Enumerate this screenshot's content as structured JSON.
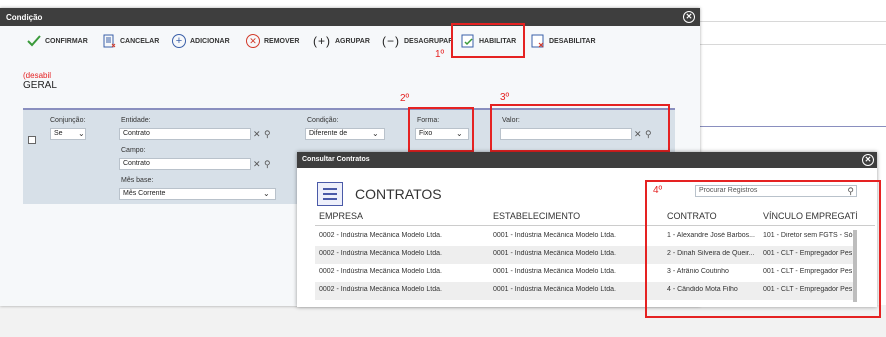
{
  "dialog": {
    "title": "Condição",
    "toolbar": {
      "confirmar": "CONFIRMAR",
      "cancelar": "CANCELAR",
      "adicionar": "ADICIONAR",
      "remover": "REMOVER",
      "agrupar": "AGRUPAR",
      "agrupar_sym": "(+)",
      "desagrupar": "DESAGRUPAR",
      "desagrupar_sym": "(−)",
      "habilitar": "HABILITAR",
      "desabilitar": "DESABILITAR"
    },
    "warning": "(desabil",
    "section": "GERAL",
    "form": {
      "conjuncao_label": "Conjunção:",
      "conjuncao_value": "Se",
      "entidade_label": "Entidade:",
      "entidade_value": "Contrato",
      "campo_label": "Campo:",
      "campo_value": "Contrato",
      "mes_base_label": "Mês base:",
      "mes_base_value": "Mês Corrente",
      "condicao_label": "Condição:",
      "condicao_value": "Diferente de",
      "forma_label": "Forma:",
      "forma_value": "Fixo",
      "valor_label": "Valor:",
      "valor_value": ""
    }
  },
  "annotations": {
    "step1": "1º",
    "step2": "2º",
    "step3": "3º",
    "step4": "4º"
  },
  "lookup": {
    "title": "Consultar Contratos",
    "heading": "CONTRATOS",
    "search_placeholder": "Procurar Registros",
    "columns": [
      "EMPRESA",
      "ESTABELECIMENTO",
      "CONTRATO",
      "VÍNCULO EMPREGATÍC"
    ],
    "rows": [
      [
        "0002 - Indústria Mecânica Modelo Ltda.",
        "0001 - Indústria Mecânica Modelo Ltda.",
        "1 - Alexandre José Barbos...",
        "101 - Diretor sem FGTS - Só"
      ],
      [
        "0002 - Indústria Mecânica Modelo Ltda.",
        "0001 - Indústria Mecânica Modelo Ltda.",
        "2 - Dinah Silveira de Queir...",
        "001 - CLT - Empregador Pes"
      ],
      [
        "0002 - Indústria Mecânica Modelo Ltda.",
        "0001 - Indústria Mecânica Modelo Ltda.",
        "3 - Afrânio Coutinho",
        "001 - CLT - Empregador Pes"
      ],
      [
        "0002 - Indústria Mecânica Modelo Ltda.",
        "0001 - Indústria Mecânica Modelo Ltda.",
        "4 - Cândido Mota Filho",
        "001 - CLT - Empregador Pes"
      ]
    ]
  },
  "colors": {
    "titlebar": "#3e3e3e",
    "highlight": "#e52222",
    "panel": "#d7e0e8",
    "accent": "#8a8fbf"
  },
  "icons": [
    "close-icon",
    "check-icon",
    "clipboard-cancel-icon",
    "plus-circle-icon",
    "x-circle-icon",
    "habilitar-icon",
    "desabilitar-icon",
    "clear-icon",
    "search-icon",
    "chevron-down-icon",
    "list-icon"
  ]
}
